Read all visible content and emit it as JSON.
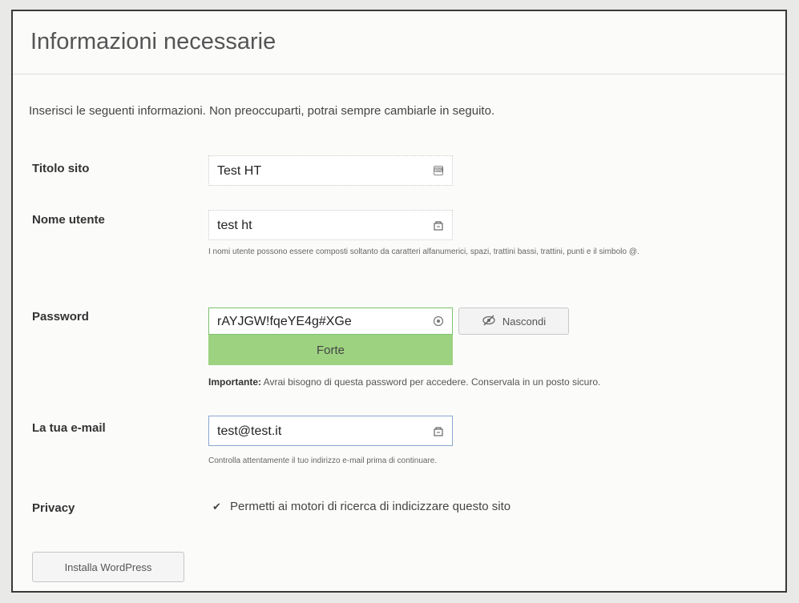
{
  "heading": "Informazioni necessarie",
  "intro": "Inserisci le seguenti informazioni. Non preoccuparti, potrai sempre cambiarle in seguito.",
  "fields": {
    "site_title": {
      "label": "Titolo sito",
      "value": "Test HT"
    },
    "username": {
      "label": "Nome utente",
      "value": "test ht",
      "hint": "I nomi utente possono essere composti soltanto da caratteri alfanumerici, spazi, trattini bassi, trattini, punti e il simbolo @."
    },
    "password": {
      "label": "Password",
      "value": "rAYJGW!fqeYE4g#XGe",
      "strength": "Forte",
      "hide_button": "Nascondi",
      "important_bold": "Importante:",
      "important_text": " Avrai bisogno di questa password per accedere. Conservala in un posto sicuro."
    },
    "email": {
      "label": "La tua e-mail",
      "value": "test@test.it",
      "hint": "Controlla attentamente il tuo indirizzo e-mail prima di continuare."
    },
    "privacy": {
      "label": "Privacy",
      "checkbox_label": "Permetti ai motori di ricerca di indicizzare questo sito",
      "checked": true
    }
  },
  "install_button": "Installa WordPress",
  "icons": {
    "site_title_field": "keyboard-icon",
    "username_field": "autofill-icon",
    "password_field": "reveal-icon",
    "hide_button": "eye-slash-icon",
    "email_field": "autofill-icon",
    "privacy_checkbox": "checkbox-checked-icon"
  }
}
